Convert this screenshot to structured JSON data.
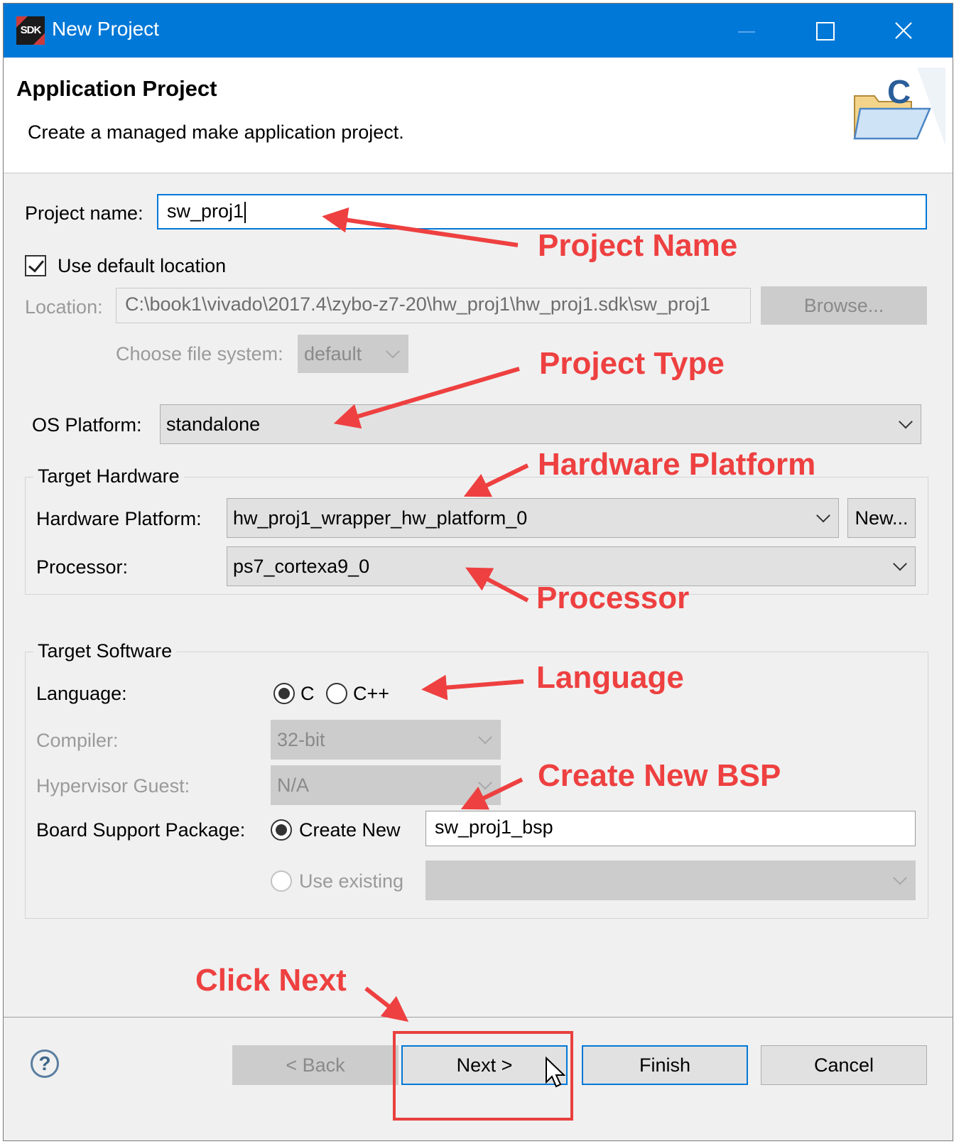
{
  "window": {
    "app_icon_text": "SDK",
    "title": "New Project"
  },
  "header": {
    "title": "Application Project",
    "description": "Create a managed make application project."
  },
  "project": {
    "name_label": "Project name:",
    "name_value": "sw_proj1",
    "use_default_label": "Use default location",
    "use_default_checked": true,
    "location_label": "Location:",
    "location_value": "C:\\book1\\vivado\\2017.4\\zybo-z7-20\\hw_proj1\\hw_proj1.sdk\\sw_proj1",
    "browse_label": "Browse...",
    "filesystem_label": "Choose file system:",
    "filesystem_value": "default"
  },
  "os": {
    "label": "OS Platform:",
    "value": "standalone"
  },
  "target_hardware": {
    "title": "Target Hardware",
    "hw_platform_label": "Hardware Platform:",
    "hw_platform_value": "hw_proj1_wrapper_hw_platform_0",
    "new_button": "New...",
    "processor_label": "Processor:",
    "processor_value": "ps7_cortexa9_0"
  },
  "target_software": {
    "title": "Target Software",
    "language_label": "Language:",
    "language_options": [
      "C",
      "C++"
    ],
    "language_selected": "C",
    "compiler_label": "Compiler:",
    "compiler_value": "32-bit",
    "hypervisor_label": "Hypervisor Guest:",
    "hypervisor_value": "N/A",
    "bsp_label": "Board Support Package:",
    "bsp_create_new_label": "Create New",
    "bsp_create_new_value": "sw_proj1_bsp",
    "bsp_use_existing_label": "Use existing",
    "bsp_selected": "Create New"
  },
  "footer": {
    "help_symbol": "?",
    "back_label": "< Back",
    "next_label": "Next >",
    "finish_label": "Finish",
    "cancel_label": "Cancel"
  },
  "annotations": {
    "project_name": "Project Name",
    "project_type": "Project Type",
    "hardware_platform": "Hardware Platform",
    "processor": "Processor",
    "language": "Language",
    "create_new_bsp": "Create New BSP",
    "click_next": "Click Next",
    "color": "#ee4040"
  },
  "colors": {
    "titlebar": "#0078d7",
    "focus_border": "#0078d7",
    "dialog_bg": "#f0f0f0"
  }
}
